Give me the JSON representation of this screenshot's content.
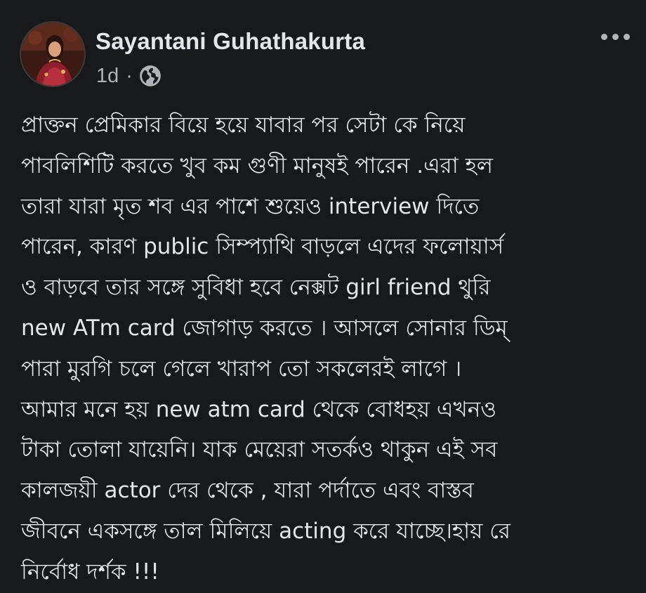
{
  "post": {
    "author": "Sayantani Guhathakurta",
    "time": "1d",
    "separator": "·",
    "audience_icon": "globe-icon",
    "more_icon": "more-options-icon",
    "lines": [
      "প্রাক্তন প্রেমিকার বিয়ে হয়ে যাবার পর সেটা কে নিয়ে",
      "পাবলিশিটি করতে খুব কম গুণী মানুষই পারেন .এরা হল",
      "তারা যারা মৃত শব এর পাশে শুয়েও interview দিতে",
      "পারেন, কারণ public সিম্প্যাথি বাড়লে এদের ফলোয়ার্স",
      "ও বাড়বে তার সঙ্গে সুবিধা হবে নেক্সট girl friend থুরি",
      "new ATm card জোগাড় করতে । আসলে সোনার ডিম্",
      "পারা মুরগি চলে গেলে খারাপ তো সকলেরই লাগে ।",
      "আমার মনে হয় new atm card থেকে বোধহয় এখনও",
      "টাকা তোলা যায়েনি। যাক মেয়েরা সতর্কও থাকুন এই সব",
      "কালজয়ী actor দের থেকে , যারা পর্দাতে এবং বাস্তব",
      "জীবনে একসঙ্গে তাল মিলিয়ে acting করে যাচ্ছে।হায় রে",
      "নির্বোধ দর্শক !!!"
    ]
  },
  "colors": {
    "background": "#18191a",
    "primary_text": "#e4e6eb",
    "secondary_text": "#b0b3b8"
  }
}
